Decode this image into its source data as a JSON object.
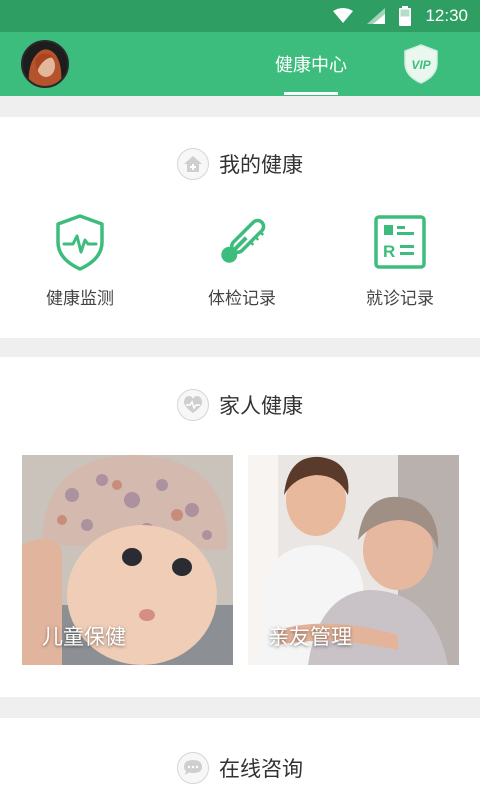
{
  "status_bar": {
    "time": "12:30"
  },
  "header": {
    "tab_title": "健康中心",
    "vip_label": "VIP"
  },
  "sections": {
    "my_health": {
      "title": "我的健康",
      "items": [
        {
          "label": "健康监测",
          "icon": "shield-heartbeat-icon"
        },
        {
          "label": "体检记录",
          "icon": "thermometer-icon"
        },
        {
          "label": "就诊记录",
          "icon": "medical-record-icon"
        }
      ]
    },
    "family_health": {
      "title": "家人健康",
      "cards": [
        {
          "label": "儿童保健",
          "icon": "baby-photo"
        },
        {
          "label": "亲友管理",
          "icon": "caregiver-elder-photo"
        }
      ]
    },
    "online_consult": {
      "title": "在线咨询"
    }
  },
  "colors": {
    "status": "#2f9e63",
    "header": "#3dbd7d",
    "accent": "#3dbd7d"
  }
}
